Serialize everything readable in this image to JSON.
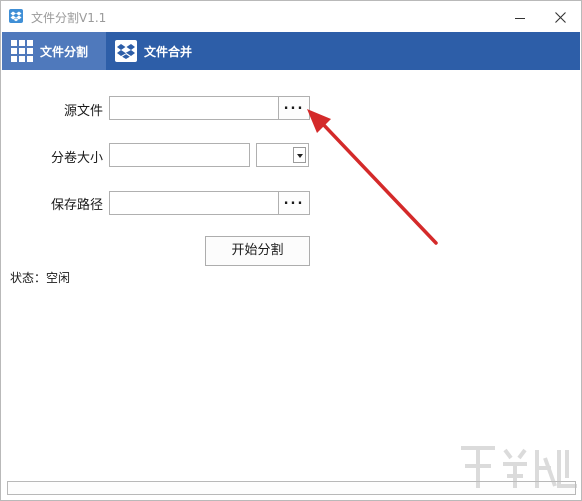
{
  "window": {
    "title": "文件分割V1.1"
  },
  "tabs": [
    {
      "label": "文件分割",
      "active": true
    },
    {
      "label": "文件合并",
      "active": false
    }
  ],
  "form": {
    "source_label": "源文件",
    "source_value": "",
    "volume_label": "分卷大小",
    "volume_value": "",
    "volume_unit": "",
    "save_label": "保存路径",
    "save_value": "",
    "browse_label": "...",
    "start_label": "开始分割"
  },
  "status": {
    "text": "状态：空闲"
  },
  "progress": {
    "value": 0
  },
  "colors": {
    "tabbar": "#2d5ea8",
    "active_tab": "#4f79bc",
    "annotation": "#d42a2a"
  },
  "icons": {
    "app": "dropbox-icon",
    "tab_split": "grid-icon",
    "tab_merge": "dropbox-icon"
  }
}
